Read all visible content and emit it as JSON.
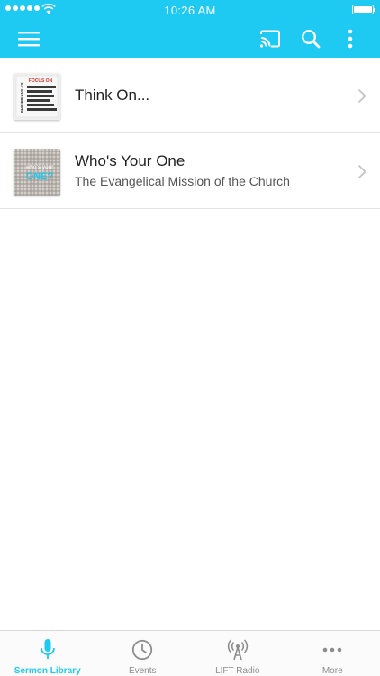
{
  "status_bar": {
    "time": "10:26 AM"
  },
  "colors": {
    "accent": "#1ec9f2",
    "tab_inactive": "#8d8d8d"
  },
  "toolbar": {
    "menu_icon": "hamburger-icon",
    "cast_icon": "cast-icon",
    "search_icon": "search-icon",
    "more_icon": "vertical-dots-icon"
  },
  "sermons": [
    {
      "title": "Think On...",
      "subtitle": "",
      "thumbnail_text": "FOCUS ON",
      "thumbnail_side_text": "PHILIPPIANS 4:8"
    },
    {
      "title": "Who's Your One",
      "subtitle": "The Evangelical Mission of the Church",
      "thumbnail_text": "who's your",
      "thumbnail_big_text": "ONE?"
    }
  ],
  "tabs": [
    {
      "label": "Sermon Library",
      "icon": "microphone-icon",
      "active": true
    },
    {
      "label": "Events",
      "icon": "clock-icon",
      "active": false
    },
    {
      "label": "LIFT Radio",
      "icon": "radio-antenna-icon",
      "active": false
    },
    {
      "label": "More",
      "icon": "more-dots-icon",
      "active": false
    }
  ]
}
